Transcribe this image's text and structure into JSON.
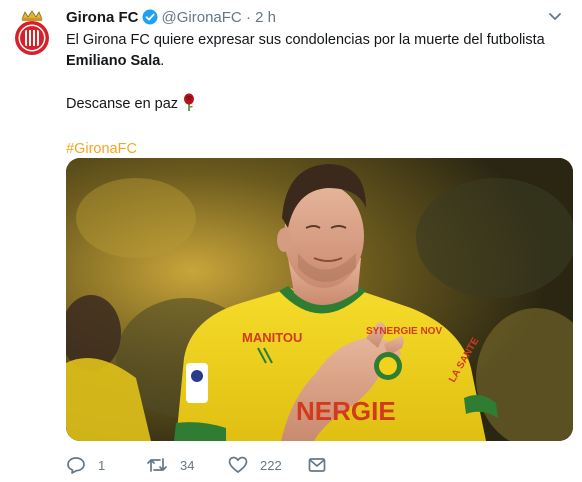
{
  "account": {
    "name": "Girona FC",
    "handle": "@GironaFC",
    "separator": "·",
    "time": "2 h"
  },
  "tweet": {
    "line1": "El Girona FC quiere expresar sus condolencias por la muerte del futbolista",
    "line2_bold": "Emiliano Sala",
    "line2_tail": ".",
    "line3": "Descanse en paz",
    "hashtag": "#GironaFC"
  },
  "photo": {
    "sponsor_chest": "MANITOU",
    "sponsor_main": "NERGIE",
    "sponsor_shoulder": "SYNERGIE NOV",
    "sleeve_text": "LA SANTE",
    "jersey_color": "#f2d21b",
    "trim_color": "#2f7d32"
  },
  "actions": {
    "replies": "1",
    "retweets": "34",
    "likes": "222"
  },
  "colors": {
    "hashtag": "#f5a623",
    "muted": "#657786",
    "verified": "#1da1f2"
  }
}
